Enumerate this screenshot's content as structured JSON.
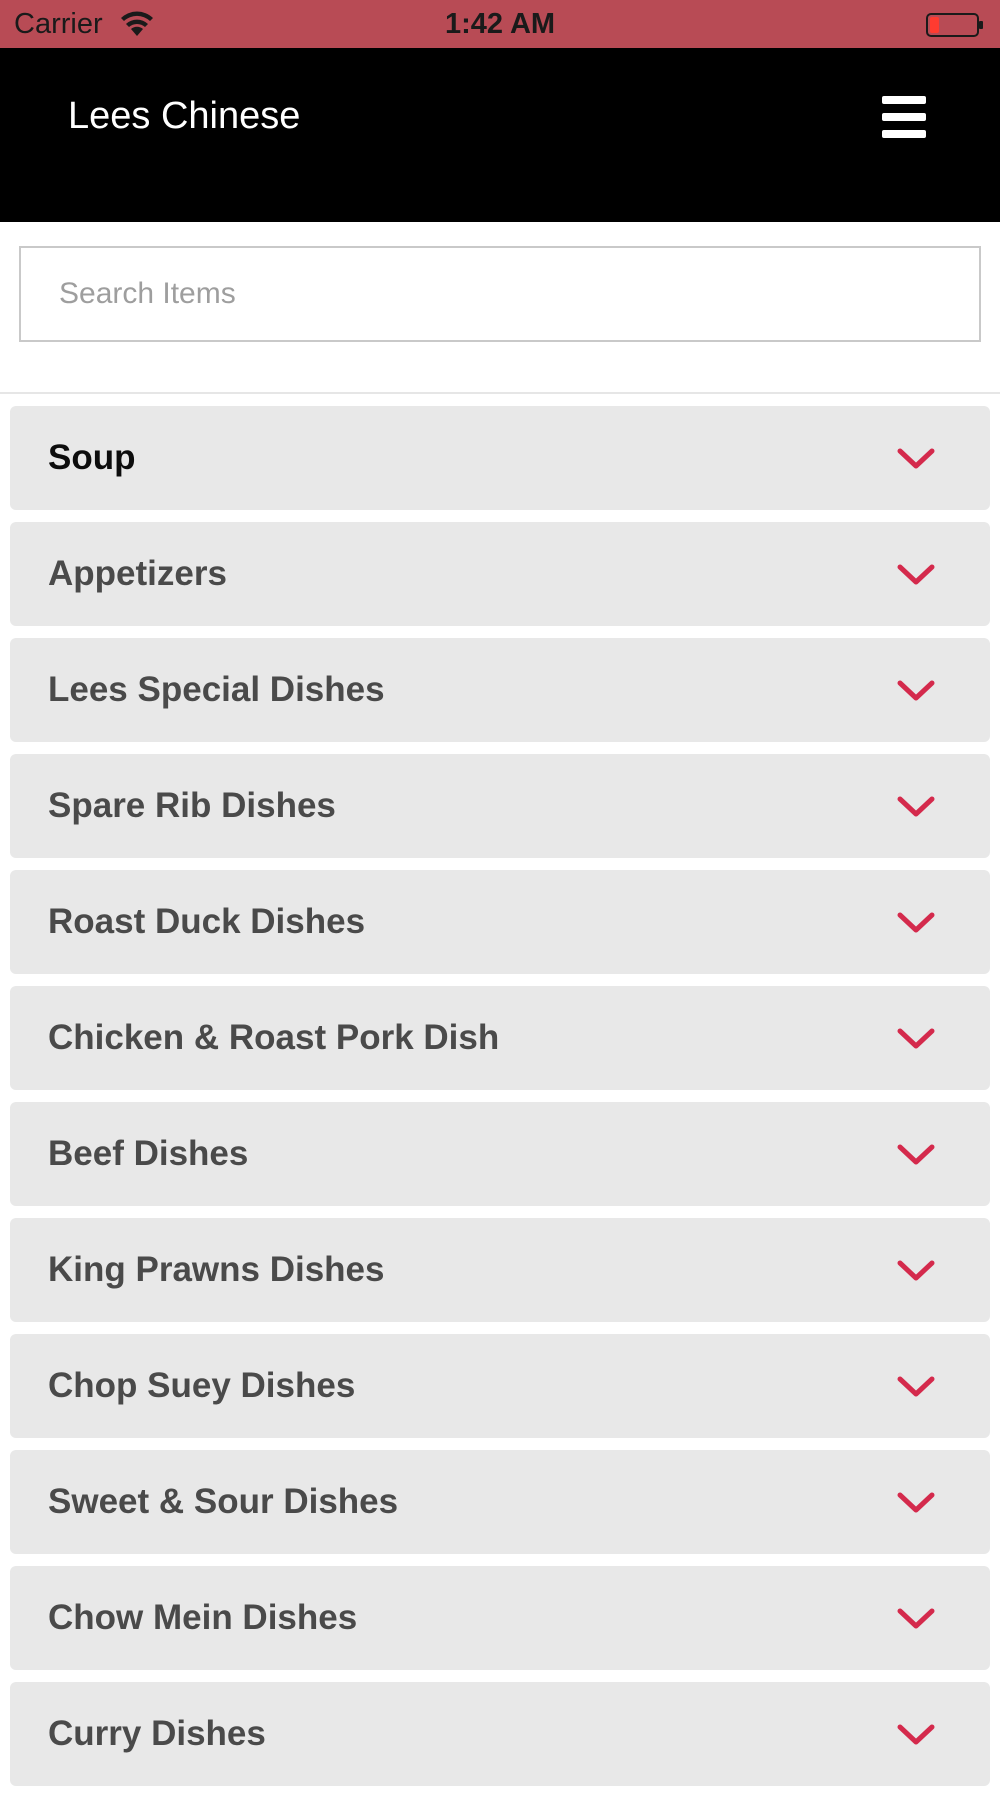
{
  "status_bar": {
    "carrier": "Carrier",
    "time": "1:42 AM",
    "wifi_icon": "wifi-icon",
    "battery_icon": "battery-low-icon",
    "battery_color": "#ff3b30"
  },
  "header": {
    "title": "Lees Chinese",
    "menu_icon": "hamburger-menu-icon",
    "background": "#000000"
  },
  "search": {
    "placeholder": "Search Items",
    "value": ""
  },
  "categories": [
    {
      "label": "Soup"
    },
    {
      "label": "Appetizers"
    },
    {
      "label": "Lees Special Dishes"
    },
    {
      "label": "Spare Rib Dishes"
    },
    {
      "label": "Roast Duck Dishes"
    },
    {
      "label": "Chicken & Roast Pork Dish"
    },
    {
      "label": "Beef Dishes"
    },
    {
      "label": "King Prawns Dishes"
    },
    {
      "label": "Chop Suey Dishes"
    },
    {
      "label": "Sweet & Sour Dishes"
    },
    {
      "label": "Chow Mein Dishes"
    },
    {
      "label": "Curry Dishes"
    }
  ],
  "colors": {
    "status_bar": "#b84b55",
    "accent_chevron": "#d42a4c",
    "category_bg": "#e8e8e8"
  }
}
